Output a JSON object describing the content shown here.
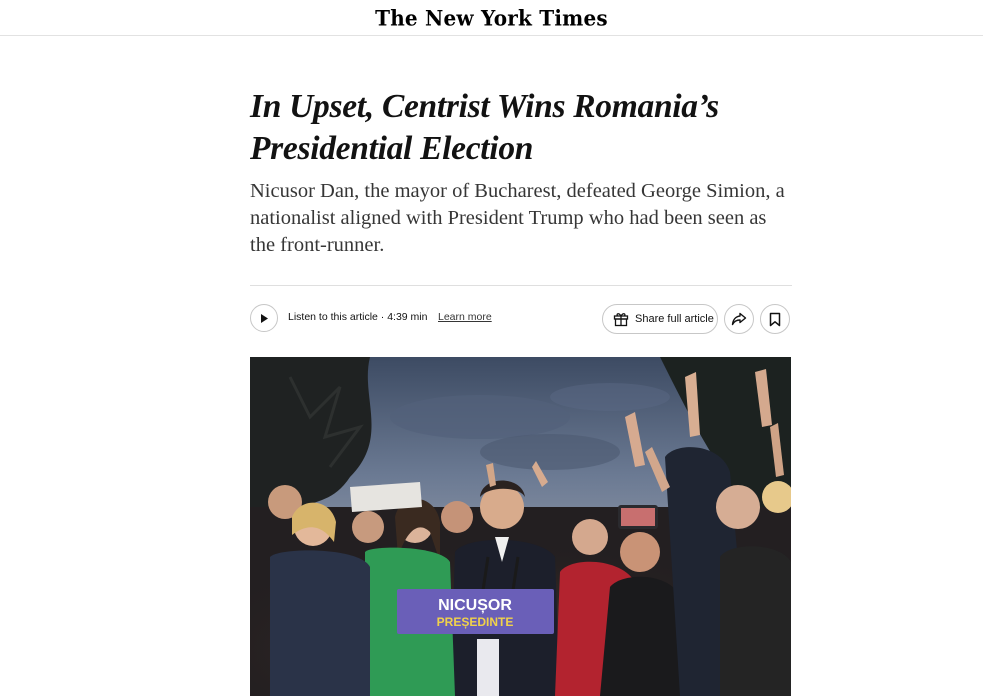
{
  "masthead": {
    "logo_text": "The New York Times"
  },
  "article": {
    "headline_line1": "In Upset, Centrist Wins Romania’s",
    "headline_line2": "Presidential Election",
    "summary": "Nicusor Dan, the mayor of Bucharest, defeated George Simion, a nationalist aligned with President Trump who had been seen as the front-runner."
  },
  "toolbar": {
    "listen_label": "Listen to this article · 4:39 min",
    "learn_more": "Learn more",
    "share_label": "Share full article"
  },
  "photo": {
    "podium_line1": "NICUȘOR",
    "podium_line2": "PREȘEDINTE"
  },
  "icons": {
    "play": "play-icon",
    "gift": "gift-icon",
    "share": "share-arrow-icon",
    "bookmark": "bookmark-icon"
  },
  "colors": {
    "text": "#121212",
    "border": "#c7c7c7",
    "podium_bg": "#6a5fb8",
    "podium_text_top": "#ffffff",
    "podium_text_bottom": "#f1d24a"
  }
}
